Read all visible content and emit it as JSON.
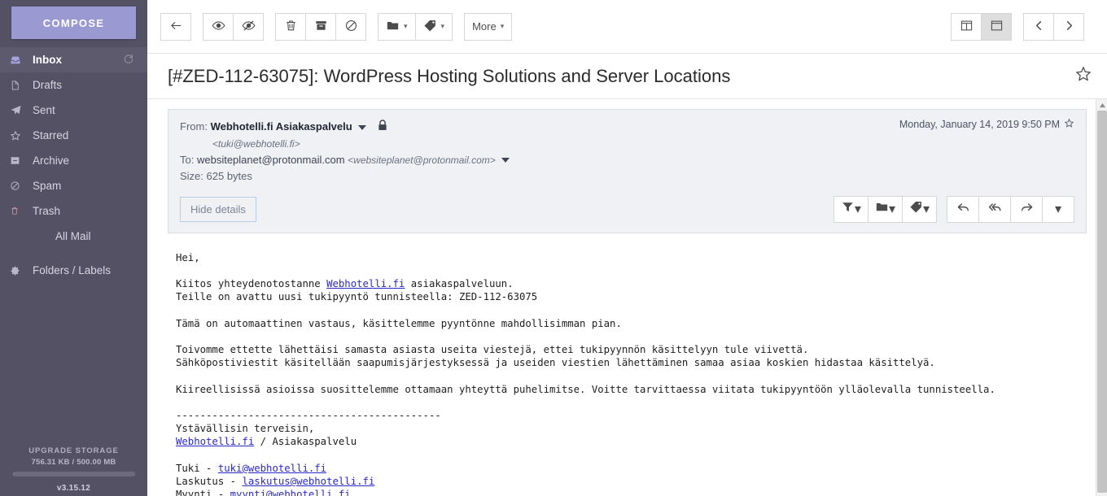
{
  "sidebar": {
    "compose_label": "COMPOSE",
    "items": [
      {
        "label": "Inbox",
        "icon": "inbox-icon",
        "active": true,
        "indent": false,
        "refresh": true
      },
      {
        "label": "Drafts",
        "icon": "draft-icon",
        "active": false,
        "indent": false,
        "refresh": false
      },
      {
        "label": "Sent",
        "icon": "send-icon",
        "active": false,
        "indent": false,
        "refresh": false
      },
      {
        "label": "Starred",
        "icon": "star-icon",
        "active": false,
        "indent": false,
        "refresh": false
      },
      {
        "label": "Archive",
        "icon": "archive-icon",
        "active": false,
        "indent": false,
        "refresh": false
      },
      {
        "label": "Spam",
        "icon": "ban-icon",
        "active": false,
        "indent": false,
        "refresh": false
      },
      {
        "label": "Trash",
        "icon": "trash-icon",
        "active": false,
        "indent": false,
        "refresh": false
      },
      {
        "label": "All Mail",
        "icon": "none",
        "active": false,
        "indent": true,
        "refresh": false
      },
      {
        "label": "Folders / Labels",
        "icon": "gear-icon",
        "active": false,
        "indent": false,
        "refresh": false
      }
    ],
    "storage": {
      "upgrade_label": "UPGRADE STORAGE",
      "quota_label": "756.31 KB / 500.00 MB",
      "used_percent": 0.15,
      "version": "v3.15.12"
    },
    "colors": {
      "background": "#555165",
      "compose": "#9a99d2",
      "active_row": "#5e5a6d"
    }
  },
  "toolbar": {
    "groups": [
      {
        "buttons": [
          {
            "name": "back-button",
            "icon": "arrow-left-icon",
            "label": "",
            "caret": false,
            "selected": false
          }
        ]
      },
      {
        "buttons": [
          {
            "name": "mark-read-button",
            "icon": "eye-icon",
            "label": "",
            "caret": false,
            "selected": false
          },
          {
            "name": "mark-unread-button",
            "icon": "eye-slash-icon",
            "label": "",
            "caret": false,
            "selected": false
          }
        ]
      },
      {
        "buttons": [
          {
            "name": "delete-button",
            "icon": "trash-icon",
            "label": "",
            "caret": false,
            "selected": false
          },
          {
            "name": "archive-button",
            "icon": "archive-icon",
            "label": "",
            "caret": false,
            "selected": false
          },
          {
            "name": "spam-button",
            "icon": "ban-icon",
            "label": "",
            "caret": false,
            "selected": false
          }
        ]
      },
      {
        "buttons": [
          {
            "name": "move-to-folder-dropdown",
            "icon": "folder-icon",
            "label": "",
            "caret": true,
            "selected": false
          },
          {
            "name": "label-dropdown",
            "icon": "tag-icon",
            "label": "",
            "caret": true,
            "selected": false
          }
        ]
      },
      {
        "buttons": [
          {
            "name": "more-dropdown",
            "icon": "none",
            "label": "More",
            "caret": true,
            "selected": false
          }
        ]
      }
    ],
    "right_groups": [
      {
        "buttons": [
          {
            "name": "layout-column-button",
            "icon": "layout-column-icon",
            "label": "",
            "caret": false,
            "selected": false
          },
          {
            "name": "layout-row-button",
            "icon": "layout-row-icon",
            "label": "",
            "caret": false,
            "selected": true
          }
        ]
      },
      {
        "buttons": [
          {
            "name": "previous-message-button",
            "icon": "chevron-left-icon",
            "label": "",
            "caret": false,
            "selected": false
          },
          {
            "name": "next-message-button",
            "icon": "chevron-right-icon",
            "label": "",
            "caret": false,
            "selected": false
          }
        ]
      }
    ]
  },
  "message": {
    "subject": "[#ZED-112-63075]: WordPress Hosting Solutions and Server Locations",
    "from_label": "From:",
    "from_name": "Webhotelli.fi Asiakaspalvelu",
    "from_address": "<tuki@webhotelli.fi>",
    "to_label": "To:",
    "to_name": "websiteplanet@protonmail.com",
    "to_address": "<websiteplanet@protonmail.com>",
    "size_label": "Size: 625 bytes",
    "date": "Monday, January 14, 2019 9:50 PM",
    "hide_details_label": "Hide details",
    "detail_buttons_left": [
      {
        "name": "filter-dropdown",
        "icon": "filter-icon",
        "caret": true
      },
      {
        "name": "move-to-folder-dropdown",
        "icon": "folder-icon",
        "caret": true
      },
      {
        "name": "label-dropdown",
        "icon": "tag-icon",
        "caret": true
      }
    ],
    "detail_buttons_right": [
      {
        "name": "reply-button",
        "icon": "reply-icon",
        "caret": false
      },
      {
        "name": "reply-all-button",
        "icon": "reply-all-icon",
        "caret": false
      },
      {
        "name": "forward-button",
        "icon": "forward-icon",
        "caret": false
      },
      {
        "name": "more-actions-dropdown",
        "icon": "none",
        "caret": true
      }
    ],
    "body_lines": [
      {
        "text": "Hei,"
      },
      {
        "text": ""
      },
      {
        "segments": [
          {
            "t": "Kiitos yhteydenotostanne "
          },
          {
            "t": "Webhotelli.fi",
            "link": true
          },
          {
            "t": " asiakaspalveluun."
          }
        ]
      },
      {
        "text": "Teille on avattu uusi tukipyyntö tunnisteella: ZED-112-63075"
      },
      {
        "text": ""
      },
      {
        "text": "Tämä on automaattinen vastaus, käsittelemme pyyntönne mahdollisimman pian."
      },
      {
        "text": ""
      },
      {
        "text": "Toivomme ettette lähettäisi samasta asiasta useita viestejä, ettei tukipyynnön käsittelyyn tule viivettä."
      },
      {
        "text": "Sähköpostiviestit käsitellään saapumisjärjestyksessä ja useiden viestien lähettäminen samaa asiaa koskien hidastaa käsittelyä."
      },
      {
        "text": ""
      },
      {
        "text": "Kiireellisissä asioissa suosittelemme ottamaan yhteyttä puhelimitse. Voitte tarvittaessa viitata tukipyyntöön ylläolevalla tunnisteella."
      },
      {
        "text": ""
      },
      {
        "text": "--------------------------------------------"
      },
      {
        "text": "Ystävällisin terveisin,"
      },
      {
        "segments": [
          {
            "t": "Webhotelli.fi",
            "link": true
          },
          {
            "t": " / Asiakaspalvelu"
          }
        ]
      },
      {
        "text": ""
      },
      {
        "segments": [
          {
            "t": "Tuki - "
          },
          {
            "t": "tuki@webhotelli.fi",
            "link": true
          }
        ]
      },
      {
        "segments": [
          {
            "t": "Laskutus - "
          },
          {
            "t": "laskutus@webhotelli.fi",
            "link": true
          }
        ]
      },
      {
        "segments": [
          {
            "t": "Myynti - "
          },
          {
            "t": "myynti@webhotelli.fi",
            "link": true
          }
        ]
      }
    ]
  },
  "colors": {
    "link": "#2a2ac8",
    "details_bg": "#eff1f5",
    "border": "#d6d6d6"
  }
}
